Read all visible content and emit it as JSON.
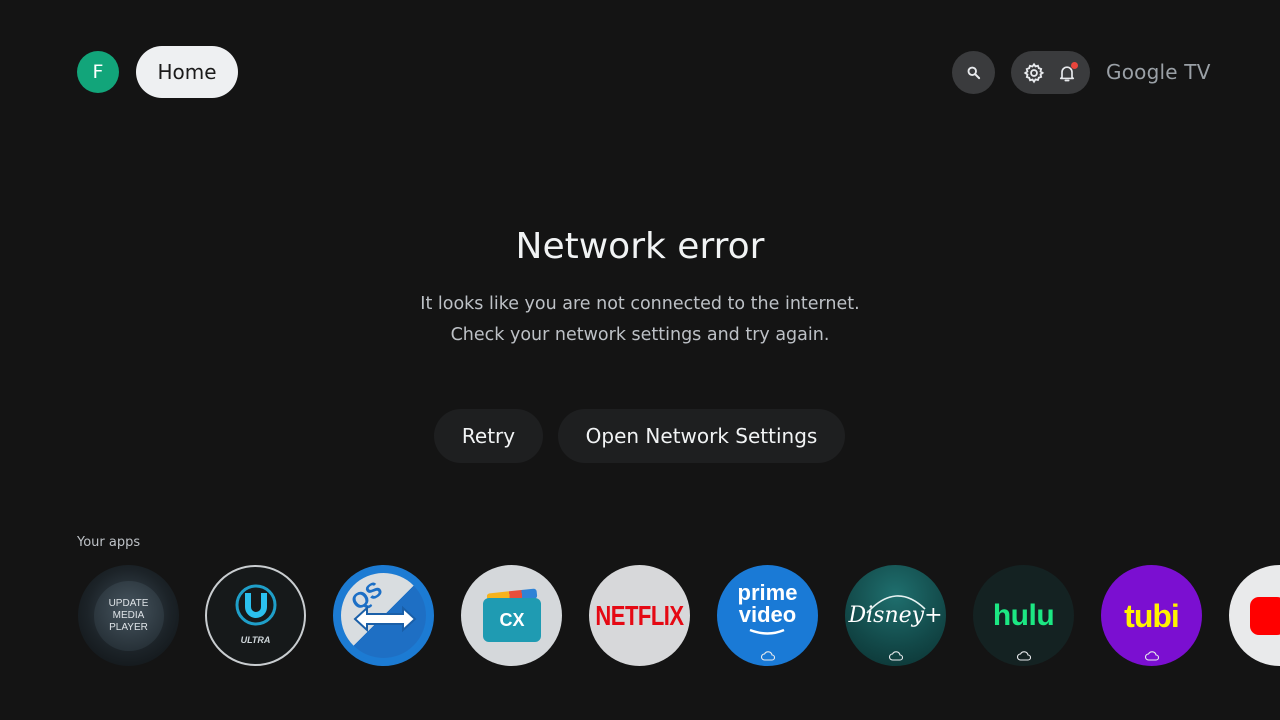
{
  "header": {
    "avatar_initial": "F",
    "home_label": "Home",
    "brand": "Google TV",
    "icons": [
      "search-icon",
      "settings-icon",
      "notifications-icon"
    ],
    "notification_dot_color": "#e8453c"
  },
  "error": {
    "title": "Network error",
    "line1": "It looks like you are not connected to the internet.",
    "line2": "Check your network settings and try again.",
    "retry_label": "Retry",
    "open_settings_label": "Open Network Settings"
  },
  "apps": {
    "label": "Your apps",
    "items": [
      {
        "name": "UPDATE MEDIA PLAYER",
        "line1": "UPDATE",
        "line2": "MEDIA",
        "line3": "PLAYER"
      },
      {
        "name": "ULTRA",
        "text": "ULTRA"
      },
      {
        "name": "QS",
        "text": "QS"
      },
      {
        "name": "CX File Explorer",
        "text": "CX"
      },
      {
        "name": "Netflix",
        "text": "NETFLIX"
      },
      {
        "name": "Prime Video",
        "line1": "prime",
        "line2": "video"
      },
      {
        "name": "Disney+",
        "text": "Disney+"
      },
      {
        "name": "Hulu",
        "text": "hulu"
      },
      {
        "name": "Tubi",
        "text": "tubi"
      },
      {
        "name": "YouTube",
        "text": ""
      }
    ]
  },
  "colors": {
    "background": "#141414",
    "avatar": "#12a57a",
    "pill_selected": "#eef0f2",
    "netflix_red": "#e50914",
    "hulu_green": "#1ce783",
    "tubi_yellow": "#fff200",
    "tubi_purple": "#7b0fd1",
    "prime_blue": "#1a7ad6"
  }
}
